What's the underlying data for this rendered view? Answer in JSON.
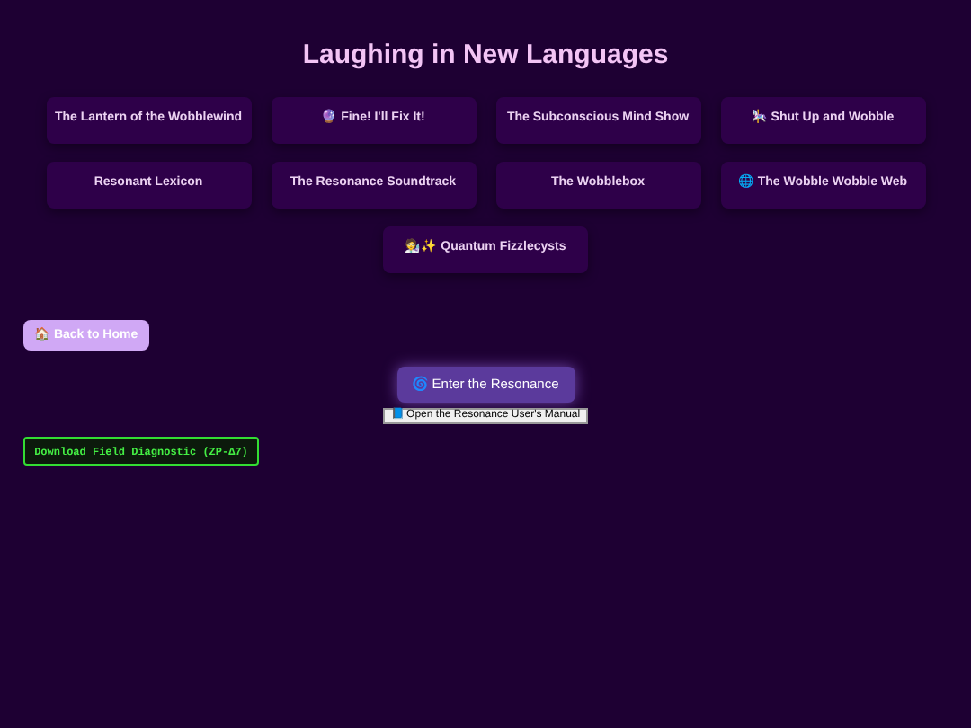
{
  "title": "Laughing in New Languages",
  "cards": [
    {
      "label": "The Lantern of the Wobblewind"
    },
    {
      "label": "🔮 Fine! I'll Fix It!"
    },
    {
      "label": "The Subconscious Mind Show"
    },
    {
      "label": "🎠 Shut Up and Wobble"
    },
    {
      "label": "Resonant Lexicon"
    },
    {
      "label": "The Resonance Soundtrack"
    },
    {
      "label": "The Wobblebox"
    },
    {
      "label": "🌐 The Wobble Wobble Web"
    },
    {
      "label": "🧑‍🔬✨ Quantum Fizzlecysts"
    }
  ],
  "back_button": "🏠 Back to Home",
  "enter_button": "🌀 Enter the Resonance",
  "manual_button": "📘 Open the Resonance User's Manual",
  "diagnostic_button": "Download Field Diagnostic (ZP-Δ7)"
}
